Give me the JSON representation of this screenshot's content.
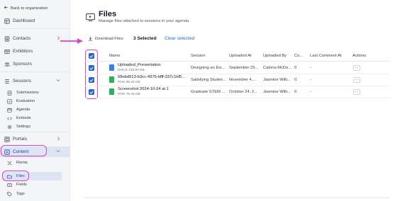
{
  "sidebar": {
    "back_label": "Back to organization",
    "items": {
      "dashboard": "Dashboard",
      "contacts": "Contacts",
      "exhibitors": "Exhibitors",
      "sponsors": "Sponsors",
      "sessions": "Sessions",
      "submissions": "Submissions",
      "evaluation": "Evaluation",
      "agenda": "Agenda",
      "embeds": "Embeds",
      "settings": "Settings",
      "portals": "Portals",
      "content": "Content",
      "remix": "Remix",
      "files": "Files",
      "fields": "Fields",
      "tags": "Tags"
    }
  },
  "header": {
    "title": "Files",
    "subtitle": "Manage files attached to sessions in your agenda"
  },
  "toolbar": {
    "download_label": "Download Files",
    "selected_count": "3 Selected",
    "clear_label": "Clear selected"
  },
  "table": {
    "headers": {
      "name": "Name",
      "session": "Session",
      "uploaded_at": "Uploaded At",
      "uploaded_by": "Uploaded By",
      "co": "Co...",
      "last_comment": "Last Comment At",
      "actions": "Actions"
    },
    "rows": [
      {
        "name": "Uploaded_Presentation",
        "meta": "DOCX 316.97 KB",
        "session": "Designing an Evi...",
        "uploaded_at": "September 29...",
        "uploaded_by": "Catrina McDe...",
        "comments": "0",
        "last_comment": "-",
        "action": "···",
        "icon_color": "#2f7ff5"
      },
      {
        "name": "68ebd913-b3cc-4975-bfff-337c1bf5...",
        "meta": "PNG 95.25 KB",
        "session": "Satisfying Studen...",
        "uploaded_at": "November 4,...",
        "uploaded_by": "Jasmine Willi...",
        "comments": "0",
        "last_comment": "-",
        "action": "···",
        "icon_color": "#22b55a"
      },
      {
        "name": "Screenshot 2024-10-24 at 1",
        "meta": "PNG 75.45 KB",
        "session": "Graduate STEM ...",
        "uploaded_at": "October 24, 2...",
        "uploaded_by": "Jasmine Willi...",
        "comments": "0",
        "last_comment": "-",
        "action": "···",
        "icon_color": "#22b55a"
      }
    ]
  },
  "colors": {
    "accent": "#2563eb",
    "highlight": "#e83ad6",
    "active_bg": "#dde5f3"
  }
}
